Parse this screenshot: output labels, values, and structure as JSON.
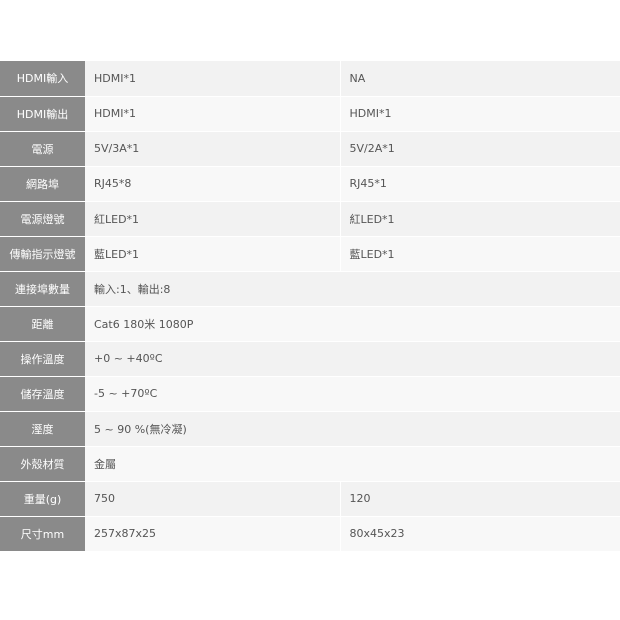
{
  "spec_table": {
    "rows": [
      {
        "label": "HDMI輸入",
        "v1": "HDMI*1",
        "v2": "NA"
      },
      {
        "label": "HDMI輸出",
        "v1": "HDMI*1",
        "v2": "HDMI*1"
      },
      {
        "label": "電源",
        "v1": "5V/3A*1",
        "v2": "5V/2A*1"
      },
      {
        "label": "網路埠",
        "v1": "RJ45*8",
        "v2": "RJ45*1"
      },
      {
        "label": "電源燈號",
        "v1": "紅LED*1",
        "v2": "紅LED*1"
      },
      {
        "label": "傳輸指示燈號",
        "v1": "藍LED*1",
        "v2": "藍LED*1"
      },
      {
        "label": "連接埠數量",
        "v1": "輸入:1、輸出:8"
      },
      {
        "label": "距離",
        "v1": "Cat6 180米 1080P"
      },
      {
        "label": "操作溫度",
        "v1": "+0 ~ +40ºC"
      },
      {
        "label": "儲存溫度",
        "v1": "-5 ~ +70ºC"
      },
      {
        "label": "溼度",
        "v1": "5 ~ 90 %(無冷凝)"
      },
      {
        "label": "外殼材質",
        "v1": "金屬"
      },
      {
        "label": "重量(g)",
        "v1": "750",
        "v2": "120"
      },
      {
        "label": "尺寸mm",
        "v1": "257x87x25",
        "v2": "80x45x23"
      }
    ]
  }
}
